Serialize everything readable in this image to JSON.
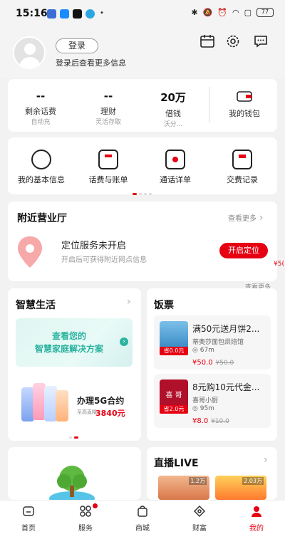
{
  "status": {
    "time": "15:16",
    "battery": "77"
  },
  "header": {
    "login_label": "登录",
    "login_hint": "登录后查看更多信息"
  },
  "stats": [
    {
      "value": "--",
      "label": "剩余话费",
      "sub": "自动充"
    },
    {
      "value": "--",
      "label": "理财",
      "sub": "灵活存取"
    },
    {
      "value": "20万",
      "label": "借钱",
      "sub": "沃分..."
    },
    {
      "value": "",
      "label": "我的钱包",
      "sub": ""
    }
  ],
  "services": [
    {
      "label": "我的基本信息",
      "icon": "user-card-icon"
    },
    {
      "label": "话费与账单",
      "icon": "bill-icon"
    },
    {
      "label": "通话详单",
      "icon": "phone-list-icon"
    },
    {
      "label": "交费记录",
      "icon": "payment-record-icon"
    }
  ],
  "nearby": {
    "title": "附近营业厅",
    "more": "查看更多",
    "status": "定位服务未开启",
    "hint": "开启后可获得附近网点信息",
    "button": "开启定位",
    "cut_text": "¥5(",
    "cut_more": "查看更多"
  },
  "smart": {
    "title": "智慧生活",
    "banner_line1": "查看您的",
    "banner_line2": "智慧家庭解决方案",
    "promo_title": "办理5G合约",
    "promo_sub": "至高直降",
    "promo_price": "3840元"
  },
  "coupons": {
    "title": "饭票",
    "items": [
      {
        "title": "满50元送月饼2...",
        "shop": "蒂奥莎面包烘焙馆",
        "distance": "67m",
        "tag": "省0.0元",
        "price": "¥50.0",
        "old": "¥50.0"
      },
      {
        "title": "8元购10元代金...",
        "shop": "喜哥小厨",
        "distance": "95m",
        "tag": "省2.0元",
        "price": "¥8.0",
        "old": "¥10.0"
      }
    ]
  },
  "live": {
    "title": "直播LIVE",
    "badge1": "1.2万",
    "badge2": "2.03万"
  },
  "nav": [
    {
      "label": "首页",
      "icon": "home-icon"
    },
    {
      "label": "服务",
      "icon": "service-icon"
    },
    {
      "label": "商城",
      "icon": "shop-bag-icon"
    },
    {
      "label": "财富",
      "icon": "wealth-icon"
    },
    {
      "label": "我的",
      "icon": "profile-icon"
    }
  ],
  "colors": {
    "accent": "#e60012",
    "background": "#f2f2f2"
  }
}
